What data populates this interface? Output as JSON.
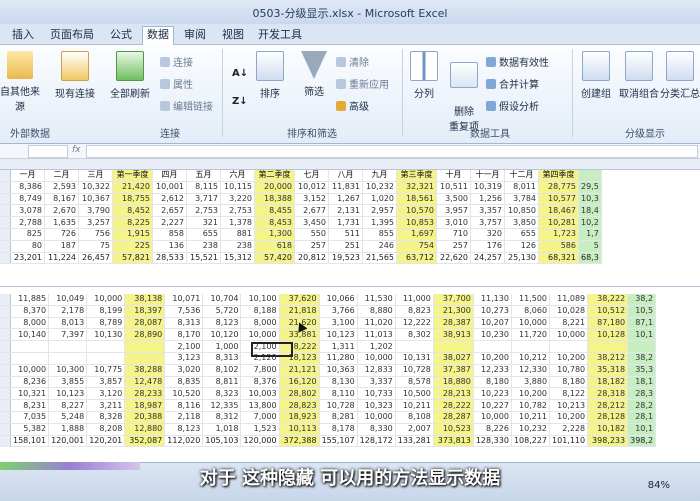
{
  "window": {
    "title": "0503-分级显示.xlsx - Microsoft Excel"
  },
  "tabs": [
    "插入",
    "页面布局",
    "公式",
    "数据",
    "审阅",
    "视图",
    "开发工具"
  ],
  "active_tab": "数据",
  "ribbon": {
    "groups": {
      "get_data": "外部数据",
      "connections": "连接",
      "sort_filter": "排序和筛选",
      "data_tools": "数据工具",
      "outline": "分级显示"
    },
    "buttons": {
      "from_source": "自其他来源",
      "existing_conn": "现有连接",
      "refresh_all": "全部刷新",
      "connections": "连接",
      "properties": "属性",
      "edit_links": "编辑链接",
      "sort": "排序",
      "filter": "筛选",
      "clear": "清除",
      "reapply": "重新应用",
      "advanced": "高级",
      "text_to_columns": "分列",
      "remove_duplicates": "删除\n重复项",
      "data_validation": "数据有效性",
      "consolidate": "合并计算",
      "what_if": "假设分析",
      "group": "创建组",
      "ungroup": "取消组合",
      "subtotal": "分类汇总"
    }
  },
  "formula_bar": {
    "fx": "fx",
    "name_box": ""
  },
  "sheet": {
    "header": [
      "一月",
      "二月",
      "三月",
      "第一季度",
      "四月",
      "五月",
      "六月",
      "第二季度",
      "七月",
      "八月",
      "九月",
      "第三季度",
      "十月",
      "十一月",
      "十二月",
      "第四季度",
      ""
    ],
    "rows_top": [
      [
        "8,386",
        "2,593",
        "10,322",
        "21,420",
        "10,001",
        "8,115",
        "10,115",
        "20,000",
        "10,012",
        "11,831",
        "10,232",
        "32,321",
        "10,511",
        "10,319",
        "8,011",
        "28,775",
        "29,5"
      ],
      [
        "8,749",
        "8,167",
        "10,367",
        "18,755",
        "2,612",
        "3,717",
        "3,220",
        "18,388",
        "3,152",
        "1,267",
        "1,020",
        "18,561",
        "3,500",
        "1,256",
        "3,784",
        "10,577",
        "10,3"
      ],
      [
        "3,078",
        "2,670",
        "3,790",
        "8,452",
        "2,657",
        "2,753",
        "2,753",
        "8,455",
        "2,677",
        "2,131",
        "2,957",
        "10,570",
        "3,957",
        "3,357",
        "10,850",
        "18,467",
        "18,4"
      ],
      [
        "2,788",
        "1,635",
        "3,257",
        "8,225",
        "2,227",
        "321",
        "1,378",
        "8,453",
        "3,450",
        "1,731",
        "1,395",
        "10,853",
        "3,010",
        "3,757",
        "3,850",
        "10,281",
        "10,2"
      ],
      [
        "825",
        "726",
        "756",
        "1,915",
        "858",
        "655",
        "881",
        "1,300",
        "550",
        "511",
        "855",
        "1,697",
        "710",
        "320",
        "655",
        "1,723",
        "1,7"
      ],
      [
        "80",
        "187",
        "75",
        "225",
        "136",
        "238",
        "238",
        "618",
        "257",
        "251",
        "246",
        "754",
        "257",
        "176",
        "126",
        "586",
        "5"
      ],
      [
        "23,201",
        "11,224",
        "26,457",
        "57,821",
        "28,533",
        "15,521",
        "15,312",
        "57,420",
        "20,812",
        "19,523",
        "21,565",
        "63,712",
        "22,620",
        "24,257",
        "25,130",
        "68,321",
        "68,3"
      ]
    ],
    "rows_bottom": [
      [
        "11,885",
        "10,049",
        "10,000",
        "38,138",
        "10,071",
        "10,704",
        "10,100",
        "37,620",
        "10,066",
        "11,530",
        "11,000",
        "37,700",
        "11,130",
        "11,500",
        "11,089",
        "38,222",
        "38,2"
      ],
      [
        "8,370",
        "2,178",
        "8,199",
        "18,397",
        "7,536",
        "5,720",
        "8,188",
        "21,818",
        "3,766",
        "8,880",
        "8,823",
        "21,300",
        "10,273",
        "8,060",
        "10,028",
        "10,512",
        "10,5"
      ],
      [
        "8,000",
        "8,013",
        "8,789",
        "28,087",
        "8,313",
        "8,123",
        "8,000",
        "21,620",
        "3,100",
        "11,020",
        "12,222",
        "28,387",
        "10,207",
        "10,000",
        "8,221",
        "87,180",
        "87,1"
      ],
      [
        "10,140",
        "7,397",
        "10,130",
        "28,890",
        "8,170",
        "10,120",
        "10,000",
        "33,881",
        "10,123",
        "11,013",
        "8,302",
        "38,913",
        "10,230",
        "11,720",
        "10,000",
        "10,128",
        "10,1"
      ],
      [
        "",
        "",
        "",
        "",
        "2,100",
        "1,000",
        "2,100",
        "8,222",
        "1,311",
        "1,202",
        "",
        "",
        "",
        "",
        "",
        "",
        ""
      ],
      [
        "",
        "",
        "",
        "",
        "3,123",
        "8,313",
        "2,120",
        "18,123",
        "11,280",
        "10,000",
        "10,131",
        "38,027",
        "10,200",
        "10,212",
        "10,200",
        "38,212",
        "38,2"
      ],
      [
        "10,000",
        "10,300",
        "10,775",
        "38,288",
        "3,020",
        "8,102",
        "7,800",
        "21,121",
        "10,363",
        "12,833",
        "10,728",
        "37,387",
        "12,233",
        "12,330",
        "10,780",
        "35,318",
        "35,3"
      ],
      [
        "8,236",
        "3,855",
        "3,857",
        "12,478",
        "8,835",
        "8,811",
        "8,376",
        "16,120",
        "8,130",
        "3,337",
        "8,578",
        "18,880",
        "8,180",
        "3,880",
        "8,180",
        "18,182",
        "18,1"
      ],
      [
        "10,321",
        "10,123",
        "3,120",
        "28,233",
        "10,520",
        "8,323",
        "10,003",
        "28,802",
        "8,110",
        "10,733",
        "10,500",
        "28,213",
        "10,223",
        "10,200",
        "8,122",
        "28,318",
        "28,3"
      ],
      [
        "8,231",
        "8,227",
        "3,211",
        "18,987",
        "8,116",
        "12,335",
        "13,800",
        "28,823",
        "10,728",
        "10,323",
        "10,211",
        "28,222",
        "10,227",
        "10,782",
        "10,213",
        "28,212",
        "28,2"
      ],
      [
        "7,035",
        "5,248",
        "8,328",
        "20,388",
        "2,118",
        "8,312",
        "7,000",
        "18,923",
        "8,281",
        "10,000",
        "8,108",
        "28,287",
        "10,000",
        "10,211",
        "10,200",
        "28,128",
        "28,1"
      ],
      [
        "5,382",
        "1,888",
        "8,208",
        "12,880",
        "8,123",
        "1,018",
        "1,523",
        "10,113",
        "8,178",
        "8,330",
        "2,007",
        "10,523",
        "8,226",
        "10,232",
        "2,228",
        "10,182",
        "10,1"
      ],
      [
        "158,101",
        "120,001",
        "120,201",
        "352,087",
        "112,020",
        "105,103",
        "120,000",
        "372,388",
        "155,107",
        "128,172",
        "133,281",
        "373,813",
        "128,330",
        "108,227",
        "101,110",
        "398,233",
        "398,2"
      ]
    ]
  },
  "subtitle": "对于 这种隐藏 可以用的方法显示数据",
  "status": {
    "zoom": "84%"
  },
  "colors": {
    "yellow_col": "#f4f48a",
    "green_col": "#c7eec0"
  }
}
